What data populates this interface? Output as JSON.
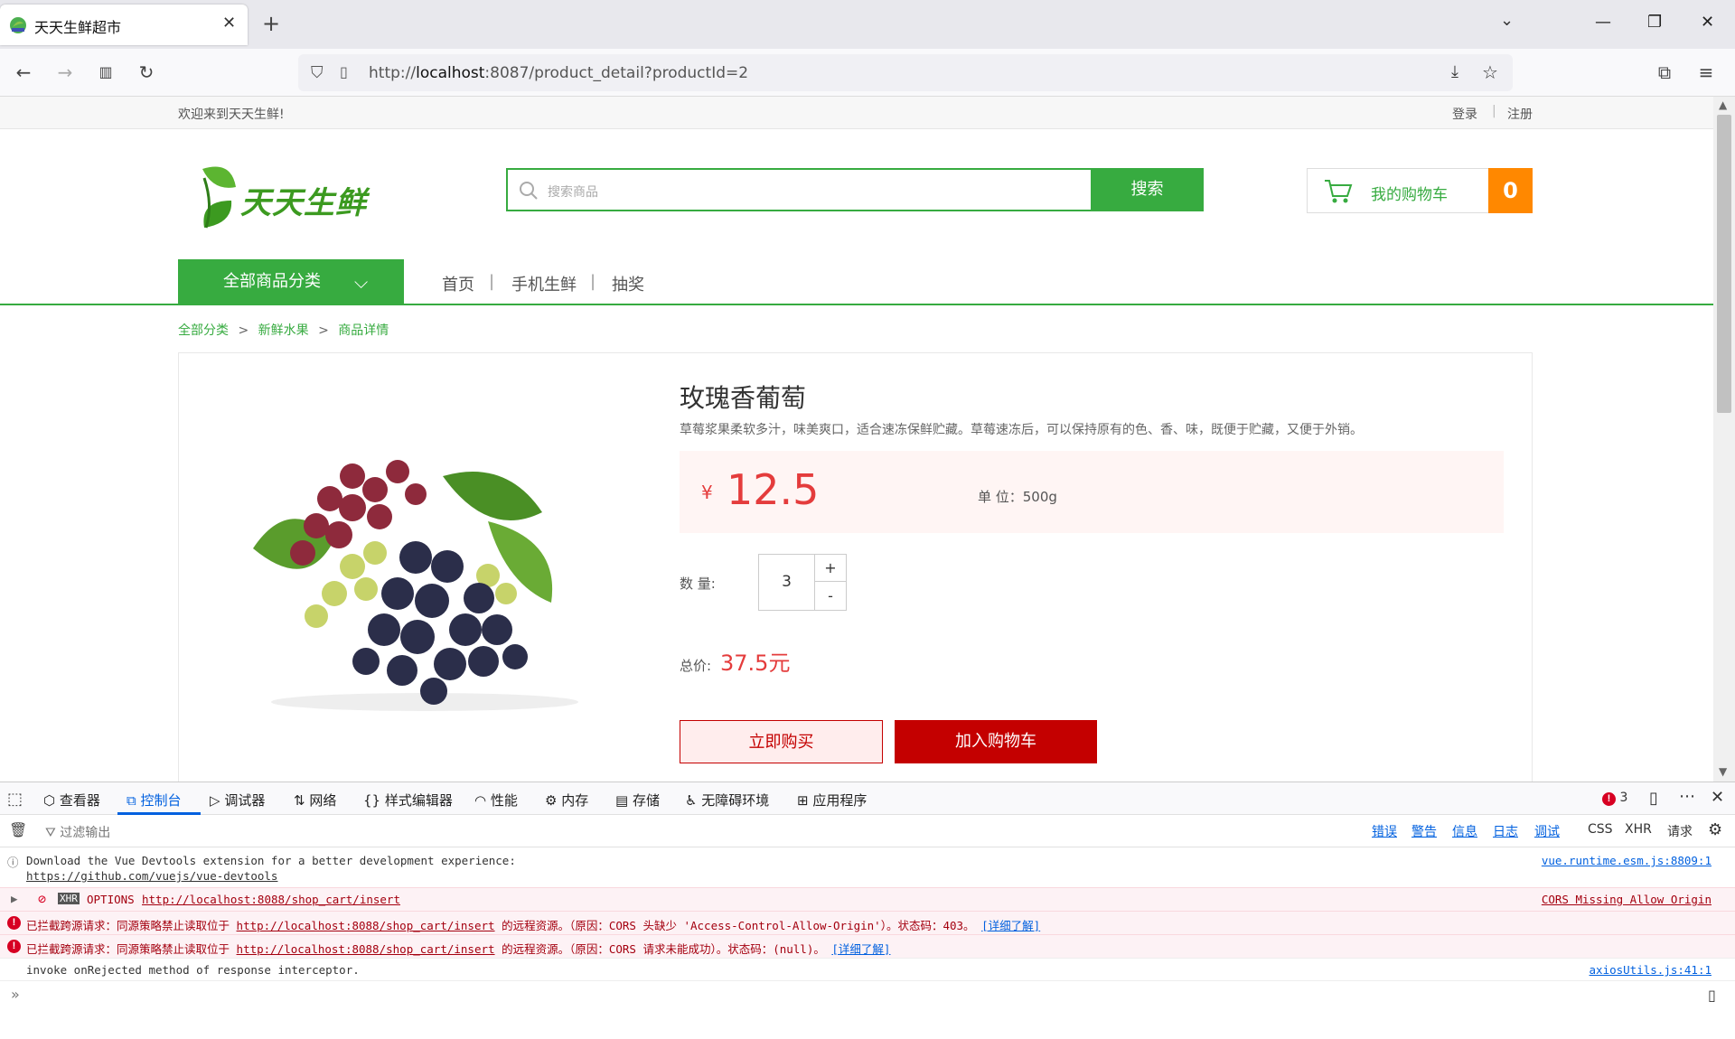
{
  "browser": {
    "tab_title": "天天生鲜超市",
    "url_prefix": "http://",
    "url_host": "localhost",
    "url_rest": ":8087/product_detail?productId=2"
  },
  "site": {
    "welcome": "欢迎来到天天生鲜!",
    "login": "登录",
    "register": "注册",
    "logo_text": "天天生鲜",
    "search_placeholder": "搜索商品",
    "search_button": "搜索",
    "cart_label": "我的购物车",
    "cart_count": "0",
    "category_button": "全部商品分类",
    "nav": [
      "首页",
      "手机生鲜",
      "抽奖"
    ],
    "breadcrumb": [
      "全部分类",
      "新鲜水果",
      "商品详情"
    ]
  },
  "product": {
    "name": "玫瑰香葡萄",
    "description": "草莓浆果柔软多汁，味美爽口，适合速冻保鲜贮藏。草莓速冻后，可以保持原有的色、香、味，既便于贮藏，又便于外销。",
    "currency": "¥",
    "price": "12.5",
    "unit_label": "单 位：500g",
    "qty_label": "数 量:",
    "qty": "3",
    "plus": "+",
    "minus": "-",
    "total_label": "总价:",
    "total": "37.5元",
    "buy_now": "立即购买",
    "add_cart": "加入购物车"
  },
  "devtools": {
    "tabs": [
      "查看器",
      "控制台",
      "调试器",
      "网络",
      "样式编辑器",
      "性能",
      "内存",
      "存储",
      "无障碍环境",
      "应用程序"
    ],
    "error_count": "3",
    "filter_placeholder": "过滤输出",
    "levels": [
      "错误",
      "警告",
      "信息",
      "日志",
      "调试"
    ],
    "extra": [
      "CSS",
      "XHR",
      "请求"
    ],
    "log1_line1": "Download the Vue Devtools extension for a better development experience:",
    "log1_line2": "https://github.com/vuejs/vue-devtools",
    "log1_src": "vue.runtime.esm.js:8809:1",
    "xhr_tag": "XHR",
    "xhr_method": "OPTIONS",
    "xhr_url": "http://localhost:8088/shop_cart/insert",
    "xhr_reason": "CORS Missing Allow Origin",
    "err1_pre": "已拦截跨源请求：同源策略禁止读取位于",
    "err1_url": "http://localhost:8088/shop_cart/insert",
    "err1_post": "的远程资源。（原因：CORS 头缺少 'Access-Control-Allow-Origin'）。状态码：403。",
    "err1_link": "[详细了解]",
    "err2_pre": "已拦截跨源请求：同源策略禁止读取位于",
    "err2_url": "http://localhost:8088/shop_cart/insert",
    "err2_post": "的远程资源。（原因：CORS 请求未能成功）。状态码：(null)。",
    "err2_link": "[详细了解]",
    "log2": "invoke onRejected method of response interceptor.",
    "log2_src": "axiosUtils.js:41:1",
    "prompt": "»"
  },
  "colors": {
    "brand_green": "#37ab40",
    "price_red": "#e43c3c",
    "buy_red": "#c40000",
    "cart_orange": "#ff8800"
  }
}
